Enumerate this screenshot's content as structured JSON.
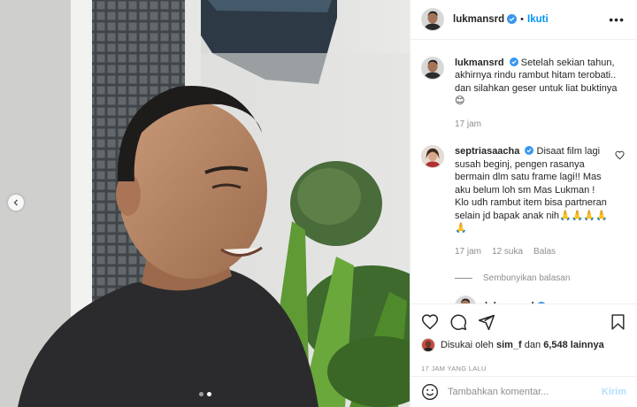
{
  "post": {
    "username": "lukmansrd",
    "follow_label": "Ikuti",
    "separator": "•",
    "more_label": "•••"
  },
  "caption": {
    "username": "lukmansrd",
    "text": "Setelah sekian tahun, akhirnya rindu rambut hitam terobati.. dan silahkan geser untuk liat buktinya 😊",
    "time": "17 jam"
  },
  "comments": [
    {
      "username": "septriasaacha",
      "text": "Disaat film lagi susah beginj, pengen rasanya bermain dlm satu frame lagi!! Mas aku belum loh sm Mas Lukman ! Klo udh rambut item bisa partneran selain jd bapak anak nih🙏🙏🙏🙏🙏",
      "time": "17 jam",
      "likes": "12 suka",
      "reply_label": "Balas"
    }
  ],
  "hide_replies_label": "Sembunyikan balasan",
  "reply": {
    "username": "lukmansrd"
  },
  "likes": {
    "prefix": "Disukai oleh",
    "user": "sim_f",
    "middle": "dan",
    "count": "6,548 lainnya"
  },
  "time_ago": "17 JAM YANG LALU",
  "composer": {
    "placeholder": "Tambahkan komentar...",
    "send_label": "Kirim"
  },
  "carousel": {
    "total": 2,
    "active": 2
  },
  "colors": {
    "link": "#0095f6",
    "verified": "#3897f0",
    "muted": "#8e8e8e",
    "send_disabled": "#b2dffc"
  },
  "icons": [
    "chevron-left-icon",
    "verified-icon",
    "heart-icon",
    "comment-icon",
    "share-icon",
    "bookmark-icon",
    "emoji-icon"
  ]
}
